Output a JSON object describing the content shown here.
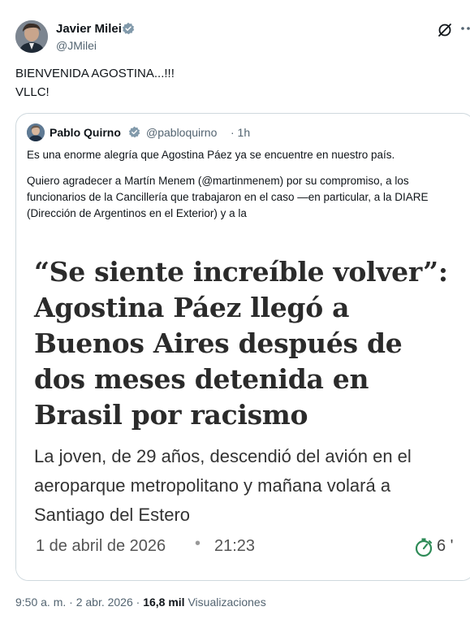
{
  "author": {
    "name": "Javier Milei",
    "handle": "@JMilei"
  },
  "tweet": {
    "text": "BIENVENIDA AGOSTINA...!!!\nVLLC!"
  },
  "quote": {
    "name": "Pablo Quirno",
    "handle": "@pabloquirno",
    "time": "· 1h",
    "paragraph1": "Es una enorme alegría que Agostina Páez ya se encuentre en nuestro país.",
    "paragraph2": "Quiero agradecer a Martín Menem (@martinmenem) por su compromiso, a los funcionarios de la Cancillería que trabajaron en el caso —en particular, a la DIARE (Dirección de Argentinos en el Exterior) y a la",
    "article": {
      "headline": "“Se siente increíble volver”: Agostina Páez llegó a Buenos Aires después de dos meses detenida en Brasil por racismo",
      "subtitle": "La joven, de 29 años, descendió del avión en el aeroparque metropolitano y mañana volará a Santiago del Estero",
      "date": "1 de abril de 2026",
      "separator": "•",
      "time": "21:23",
      "count": "6 '"
    }
  },
  "footer": {
    "time": "9:50 a. m. · 2 abr. 2026 · ",
    "views_count": "16,8 mil",
    "views_label": " Visualizaciones"
  },
  "icons": {
    "verified": "verified-badge-icon",
    "grok": "grok-icon",
    "more": "more-options-icon",
    "timer": "stopwatch-icon"
  },
  "colors": {
    "accent": "#1d9bf0",
    "secondary_text": "#536471"
  }
}
